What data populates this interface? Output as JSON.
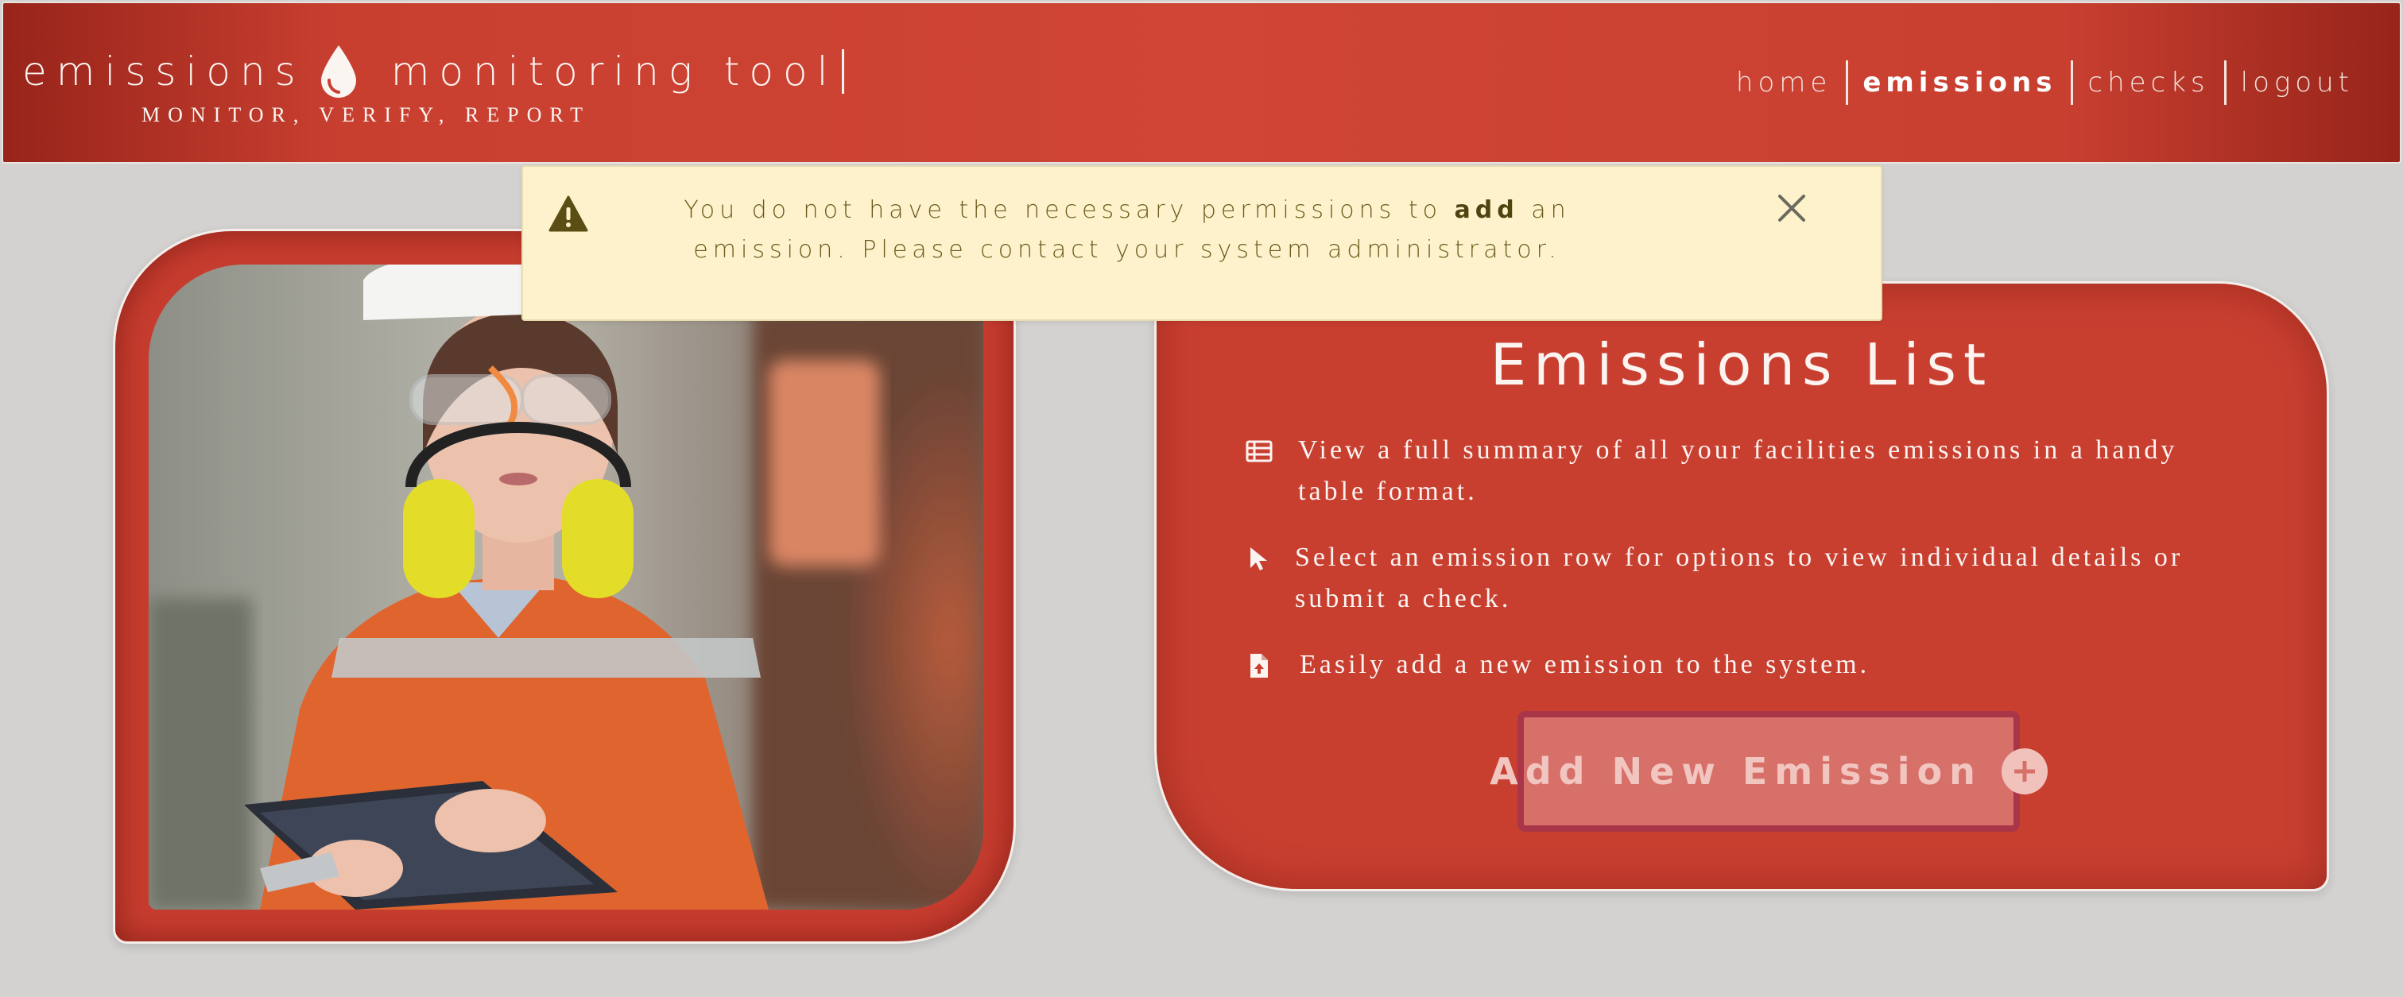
{
  "header": {
    "brand_left": "emissions",
    "brand_right": "monitoring tool",
    "tagline": "MONITOR, VERIFY, REPORT",
    "logo_icon": "droplet-icon",
    "nav": [
      {
        "label": "home",
        "active": false
      },
      {
        "label": "emissions",
        "active": true
      },
      {
        "label": "checks",
        "active": false
      },
      {
        "label": "logout",
        "active": false
      }
    ]
  },
  "alert": {
    "icon": "warning-icon",
    "text_before": "You do not have the necessary permissions to ",
    "text_bold": "add",
    "text_after": " an emission. Please contact your system administrator.",
    "close_icon": "close-icon"
  },
  "photo": {
    "alt_name": "worker-with-tablet-photo"
  },
  "emissions_card": {
    "title": "Emissions List",
    "features": [
      {
        "icon": "table-icon",
        "text": "View a full summary of all your facilities emissions in a handy table format."
      },
      {
        "icon": "cursor-icon",
        "text": "Select an emission row for options to view individual details or submit a check."
      },
      {
        "icon": "file-upload-icon",
        "text": "Easily add a new emission to the system."
      }
    ],
    "add_button": {
      "label": "Add New Emission",
      "icon": "plus-circle-icon",
      "disabled": true
    }
  },
  "colors": {
    "header_red": "#c83f30",
    "background": "#d3d2d0",
    "alert_bg": "#fdf2cb",
    "button_disabled": "#d8706a"
  }
}
